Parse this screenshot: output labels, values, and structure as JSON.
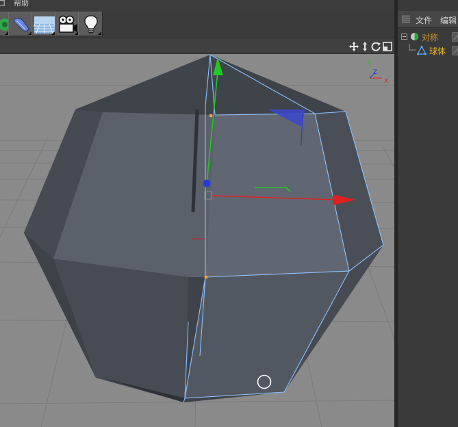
{
  "menubar": {
    "fragment_left": "口",
    "help": "帮助"
  },
  "toolbar": {
    "tools": [
      {
        "name": "gear-tool",
        "icon": "green-gear-icon"
      },
      {
        "name": "deformer-tool",
        "icon": "blue-bend-icon"
      },
      {
        "name": "floor-tool",
        "icon": "floor-grid-icon"
      },
      {
        "name": "camera-tool",
        "icon": "camera-icon"
      },
      {
        "name": "light-tool",
        "icon": "light-bulb-icon"
      }
    ]
  },
  "viewport": {
    "nav_icons": [
      "move-view-icon",
      "zoom-view-icon",
      "rotate-view-icon",
      "maximize-view-icon"
    ],
    "axis_labels": {
      "y": "Y",
      "z": "Z",
      "x": "X"
    },
    "colors": {
      "background": "#8a8a8a",
      "face_dark": "#474c54",
      "face_mid": "#5a606a",
      "face_light": "#626872",
      "edge_highlight": "#8fc3ff",
      "axis_x": "#e02020",
      "axis_y": "#22c822",
      "axis_z": "#2a3ad8",
      "point": "#f0a040"
    }
  },
  "panel": {
    "tabs": [
      "文件",
      "编辑"
    ],
    "objects": [
      {
        "label": "对称",
        "icon": "symmetry-icon",
        "color": "#c8902e"
      },
      {
        "label": "球体",
        "icon": "sphere-primitive-icon",
        "color": "#f0c020"
      }
    ]
  }
}
